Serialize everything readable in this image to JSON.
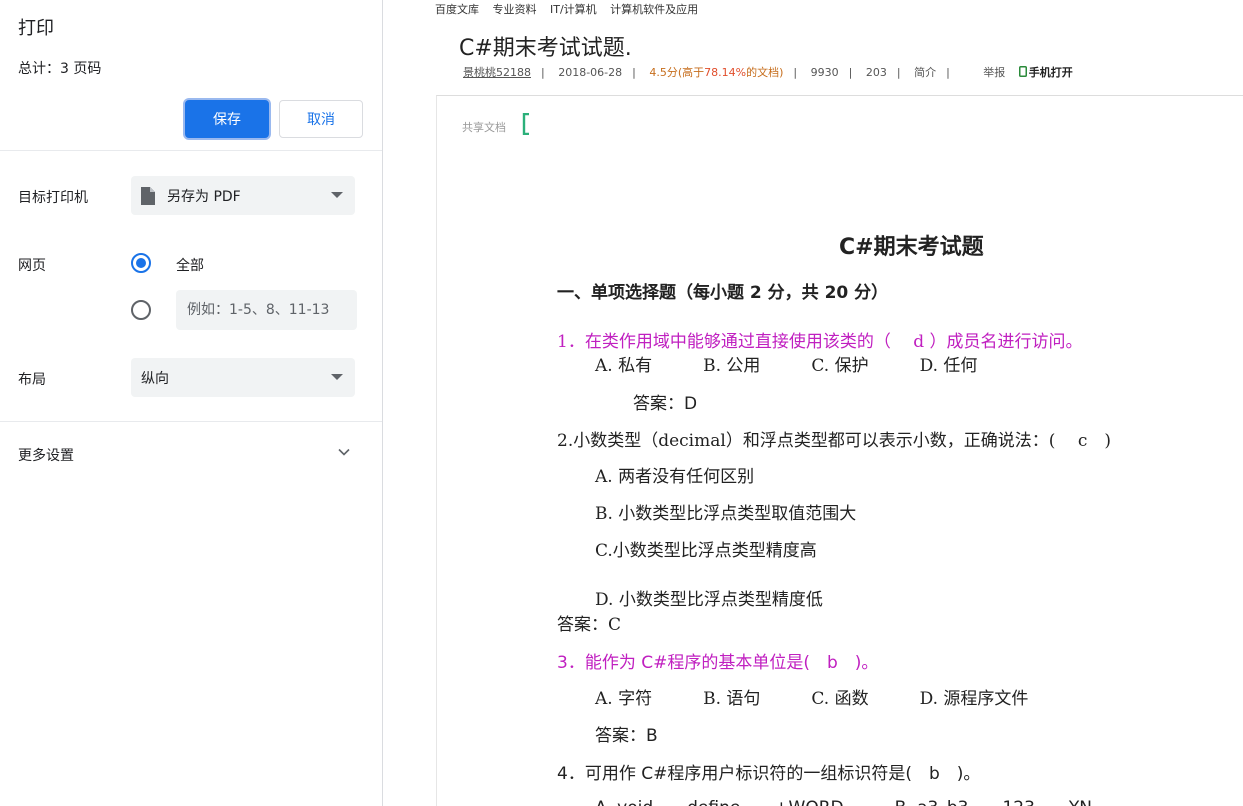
{
  "print_panel": {
    "title": "打印",
    "total": "总计：3 页码",
    "save_label": "保存",
    "cancel_label": "取消",
    "destination": {
      "label": "目标打印机",
      "value": "另存为 PDF",
      "icon": "file-icon"
    },
    "pages": {
      "label": "网页",
      "option_all": "全部",
      "selected": "全部",
      "custom_placeholder": "例如：1-5、8、11-13"
    },
    "layout": {
      "label": "布局",
      "value": "纵向"
    },
    "more_settings": "更多设置",
    "accent": "#1a73e8"
  },
  "document": {
    "breadcrumbs": [
      "百度文库",
      "专业资料",
      "IT/计算机",
      "计算机软件及应用"
    ],
    "title": "C#期末考试试题.",
    "meta": {
      "user": "景桃桃52188",
      "date": "2018-06-28",
      "score": "4.5分(高于",
      "score_pct": "78.14%",
      "score_suffix": "的文档)",
      "views": "9930",
      "downloads": "203",
      "intro": "简介",
      "report": "举报",
      "open_mobile": "手机打开"
    },
    "shared_label": "共享文档",
    "page": {
      "heading": "C#期末考试题",
      "section": "一、单项选择题（每小题 2 分，共 20 分）",
      "q1": "1．在类作用域中能够通过直接使用该类的（　 d ）成员名进行访问。",
      "q1_options": "A. 私有　　　B. 公用　　　C. 保护　　　D. 任何",
      "q1_answer": "答案：D",
      "q2": "2.小数类型（decimal）和浮点类型都可以表示小数，正确说法：( 　c　)",
      "q2_a": "A. 两者没有任何区别",
      "q2_b": "B. 小数类型比浮点类型取值范围大",
      "q2_c": "C.小数类型比浮点类型精度高",
      "q2_d": "D. 小数类型比浮点类型精度低",
      "q2_answer": "答案：C",
      "q3": "3．能作为 C#程序的基本单位是(　b　)。",
      "q3_options": "A. 字符　　　B. 语句　　　C. 函数　　　D. 源程序文件",
      "q3_answer": "答案：B",
      "q4": "4．可用作 C#程序用户标识符的一组标识符是(　b　)。",
      "q4_options": "A. void　　define　　+WORD　　　B. a3_b3　　123　　YN"
    }
  }
}
